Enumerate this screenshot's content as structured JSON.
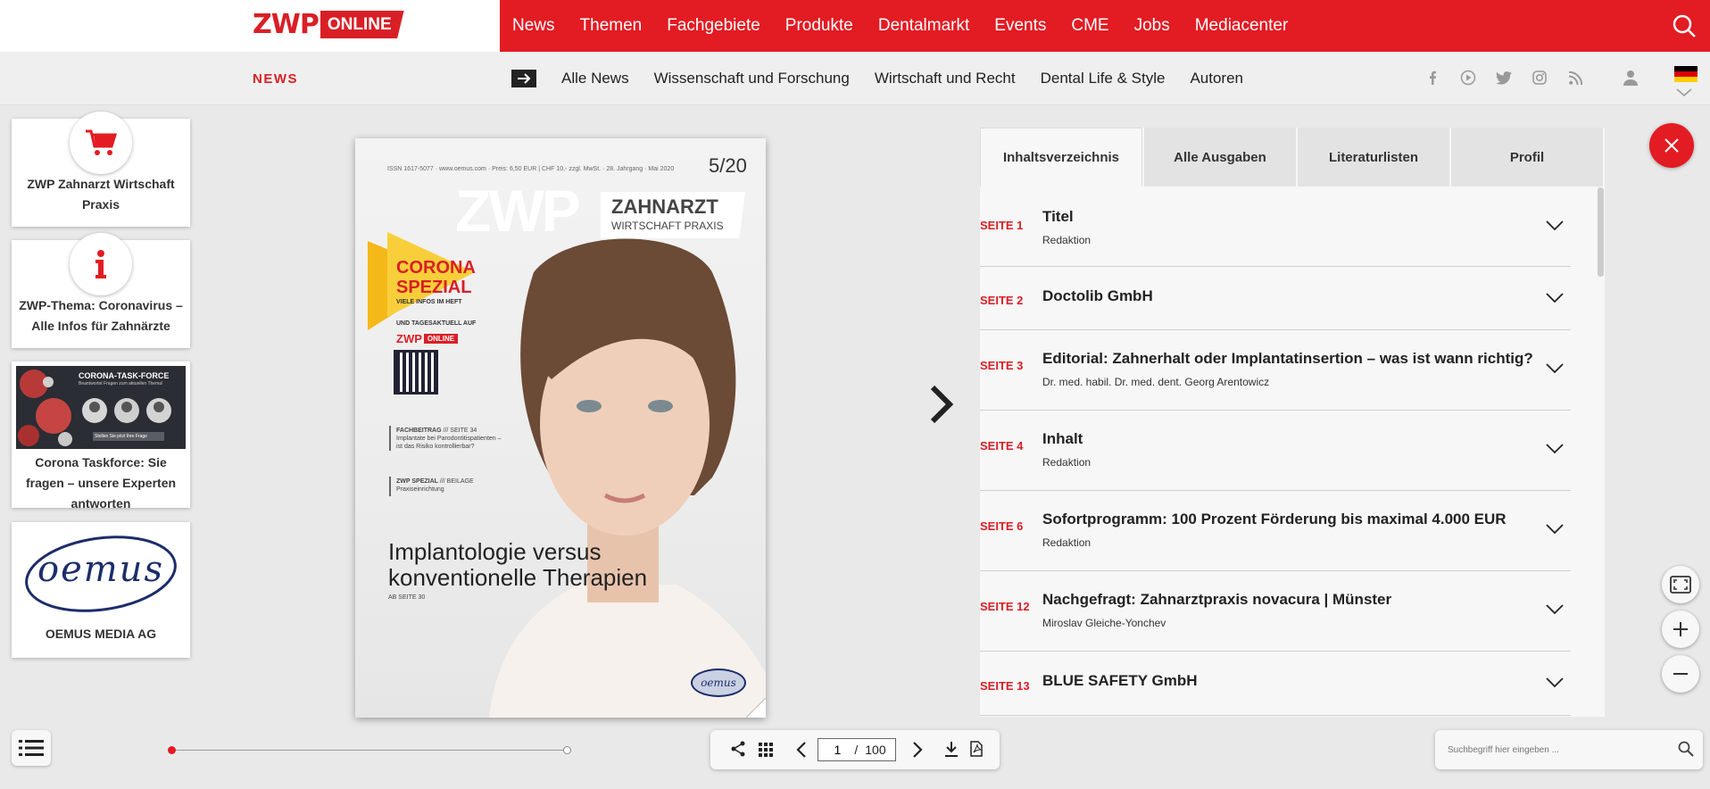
{
  "header": {
    "logo": {
      "brand": "ZWP",
      "suffix": "ONLINE"
    },
    "main_nav": [
      "News",
      "Themen",
      "Fachgebiete",
      "Produkte",
      "Dentalmarkt",
      "Events",
      "CME",
      "Jobs",
      "Mediacenter"
    ]
  },
  "subnav": {
    "section": "NEWS",
    "links": [
      "Alle News",
      "Wissenschaft und Forschung",
      "Wirtschaft und Recht",
      "Dental Life & Style",
      "Autoren"
    ],
    "social_icons": [
      "facebook-icon",
      "youtube-icon",
      "twitter-icon",
      "instagram-icon",
      "rss-icon"
    ]
  },
  "sidebar": {
    "cards": [
      {
        "label": "ZWP Zahnarzt Wirtschaft Praxis",
        "icon": "cart-icon"
      },
      {
        "label": "ZWP-Thema: Coronavirus – Alle Infos für Zahnärzte",
        "icon": "info-icon"
      },
      {
        "label": "Corona Taskforce: Sie fragen – unsere Experten antworten",
        "image_title": "CORONA-TASK-FORCE",
        "image_sub": "Beantwortet Fragen zum aktuellen Thema!",
        "image_btn": "Stellen Sie jetzt Ihre Frage"
      },
      {
        "label": "OEMUS MEDIA AG",
        "logo_text": "oemus"
      }
    ]
  },
  "magazine": {
    "issn_line": "ISSN 1617-5077 · www.oemus.com · Preis: 6,50 EUR | CHF 10,- zzgl. MwSt. · 28. Jahrgang · Mai 2020",
    "issue": "5/20",
    "masthead": "ZWP",
    "masthead_box_1": "ZAHNARZT",
    "masthead_box_2": "WIRTSCHAFT PRAXIS",
    "corona_1": "CORONA",
    "corona_2": "SPEZIAL",
    "corona_sub": "VIELE INFOS IM HEFT",
    "tagesaktuell": "UND TAGESAKTUELL AUF",
    "zwp_mini": "ZWP",
    "zwp_mini_online": "ONLINE",
    "fach_kicker": "FACHBEITRAG",
    "fach_page": "/// SEITE 34",
    "fach_text_1": "Implantate bei Parodontitispatienten –",
    "fach_text_2": "ist das Risiko kontrollierbar?",
    "spezial_kicker": "ZWP SPEZIAL",
    "spezial_page": "/// BEILAGE",
    "spezial_text": "Praxiseinrichtung",
    "headline_1": "Implantologie versus",
    "headline_2": "konventionelle Therapien",
    "headline_sub": "AB SEITE 30",
    "oemus_badge": "oemus"
  },
  "panel": {
    "tabs": [
      "Inhaltsverzeichnis",
      "Alle Ausgaben",
      "Literaturlisten",
      "Profil"
    ],
    "active_tab": "Inhaltsverzeichnis",
    "toc": [
      {
        "page": "SEITE 1",
        "title": "Titel",
        "author": "Redaktion"
      },
      {
        "page": "SEITE 2",
        "title": "Doctolib GmbH",
        "author": ""
      },
      {
        "page": "SEITE 3",
        "title": "Editorial: Zahnerhalt oder Implantatinsertion – was ist wann richtig?",
        "author": "Dr. med. habil. Dr. med. dent. Georg Arentowicz"
      },
      {
        "page": "SEITE 4",
        "title": "Inhalt",
        "author": "Redaktion"
      },
      {
        "page": "SEITE 6",
        "title": "Sofortprogramm: 100 Prozent Förderung bis maximal 4.000 EUR",
        "author": "Redaktion"
      },
      {
        "page": "SEITE 12",
        "title": "Nachgefragt: Zahnarztpraxis novacura | Münster",
        "author": "Miroslav Gleiche-Yonchev"
      },
      {
        "page": "SEITE 13",
        "title": "BLUE SAFETY GmbH",
        "author": ""
      }
    ]
  },
  "viewer": {
    "current_page": "1",
    "separator": "/",
    "total_pages": "100",
    "search_placeholder": "Suchbegriff hier eingeben ...",
    "progress": 0.0
  },
  "colors": {
    "accent": "#e31b23",
    "brand_red": "#d91f26"
  }
}
